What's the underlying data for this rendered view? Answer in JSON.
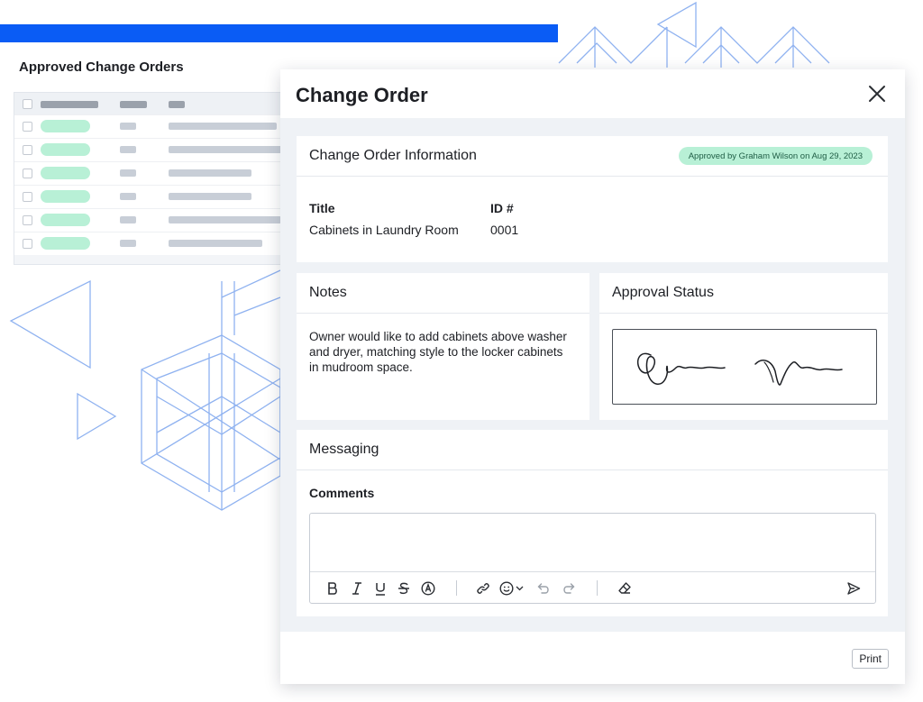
{
  "list": {
    "title": "Approved Change Orders"
  },
  "modal": {
    "title": "Change Order",
    "info": {
      "heading": "Change Order Information",
      "badge": "Approved by Graham Wilson on Aug 29, 2023",
      "title_label": "Title",
      "title_value": "Cabinets in Laundry Room",
      "id_label": "ID #",
      "id_value": "0001"
    },
    "notes": {
      "heading": "Notes",
      "text": "Owner would like to add cabinets above washer and dryer, matching style to the locker cabinets in mudroom space."
    },
    "approval": {
      "heading": "Approval Status"
    },
    "messaging": {
      "heading": "Messaging",
      "comments_label": "Comments",
      "comments_value": "",
      "toolbar": [
        "bold-icon",
        "italic-icon",
        "underline-icon",
        "strikethrough-icon",
        "text-style-icon",
        "link-icon",
        "emoji-icon",
        "undo-icon",
        "redo-icon",
        "eraser-icon",
        "send-icon"
      ]
    },
    "print_label": "Print"
  },
  "colors": {
    "accent_bar": "#0a5cf5",
    "badge_bg": "#b8f0d6",
    "badge_text": "#1f5d45",
    "pattern_stroke": "#8fb2f0"
  }
}
